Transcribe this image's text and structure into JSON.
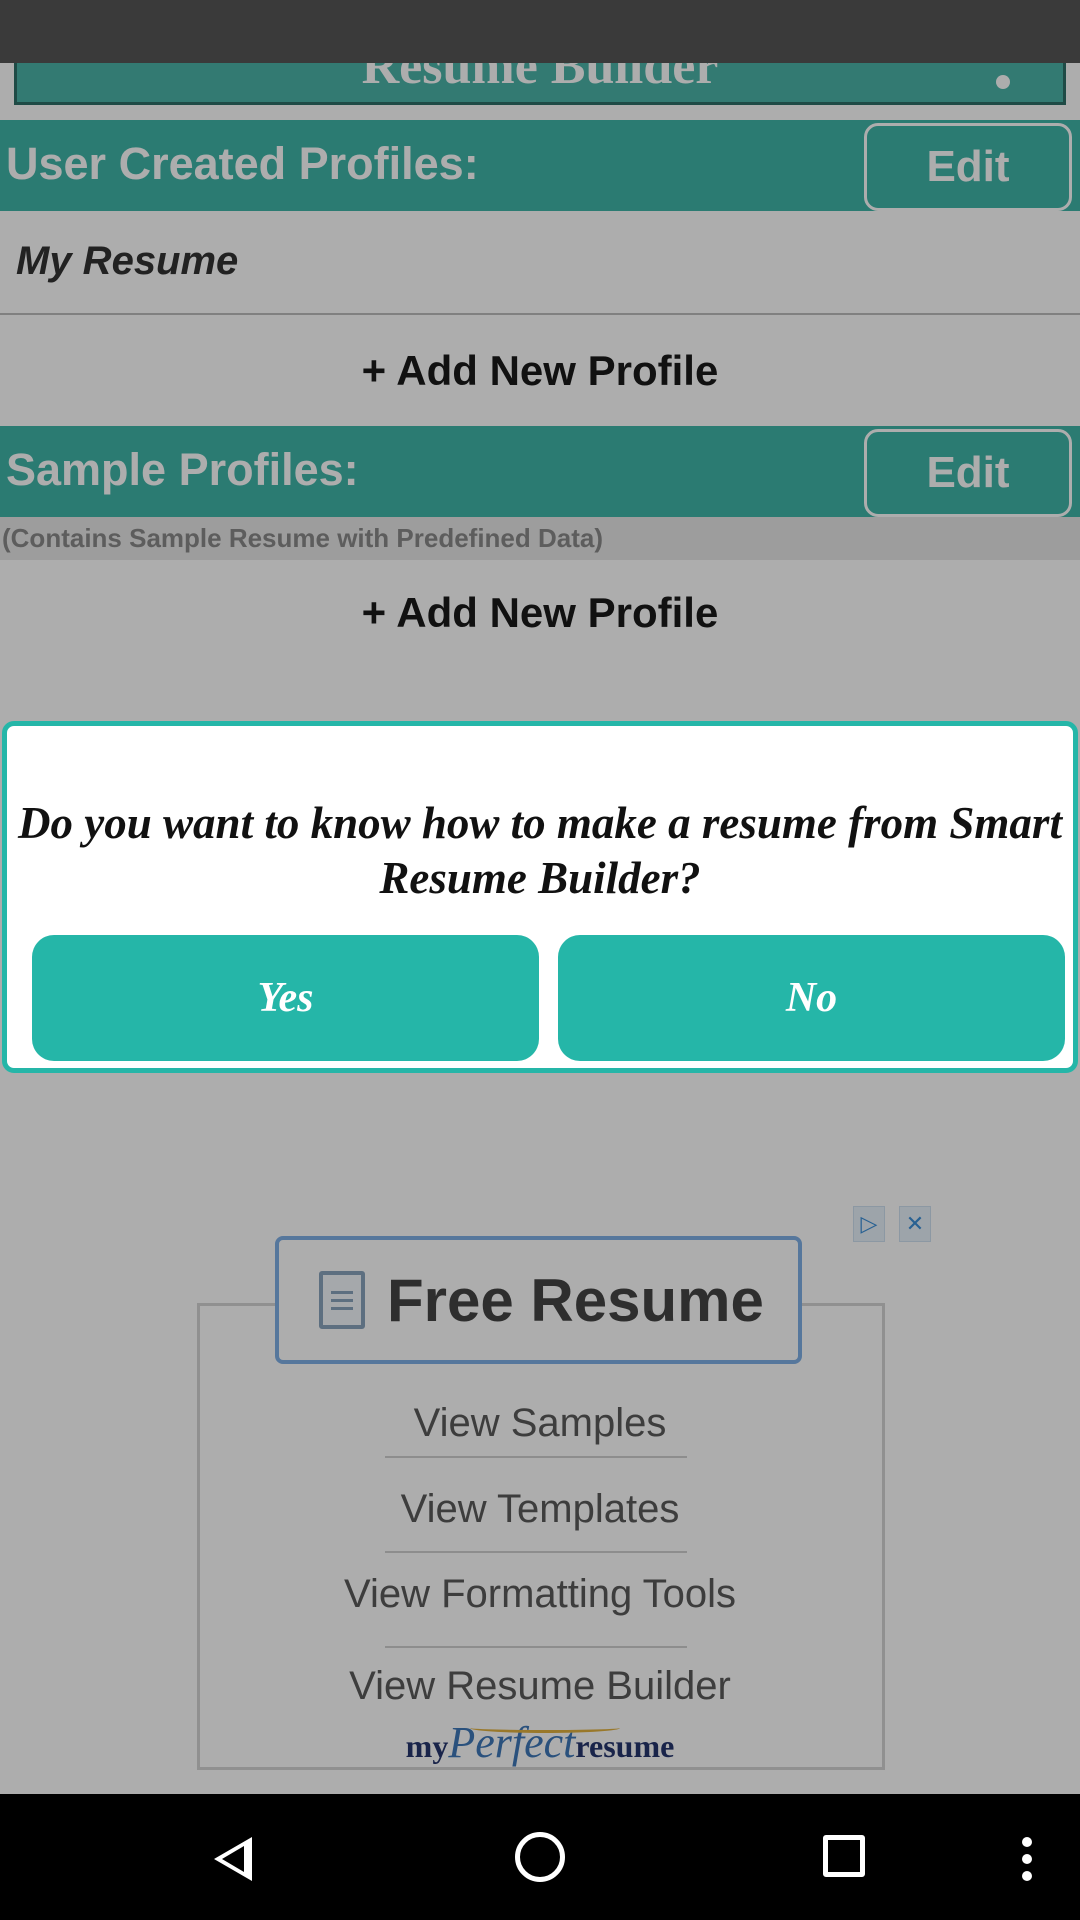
{
  "app_bar": {
    "title": "Resume Builder"
  },
  "user_profiles": {
    "header": "User Created Profiles:",
    "edit_label": "Edit",
    "items": [
      "My Resume"
    ],
    "add_label": "+ Add New Profile"
  },
  "sample_profiles": {
    "header": "Sample Profiles:",
    "edit_label": "Edit",
    "note": "(Contains Sample Resume with Predefined Data)",
    "add_label": "+ Add New Profile"
  },
  "dialog": {
    "message": "Do you want to know how to make a resume from Smart Resume Builder?",
    "yes_label": "Yes",
    "no_label": "No"
  },
  "ad": {
    "title": "Free Resume",
    "links": [
      "View Samples",
      "View Templates",
      "View Formatting Tools",
      "View Resume Builder"
    ],
    "logo_left": "my",
    "logo_mid": "Perfect",
    "logo_right": "resume",
    "adchoices_icon": "play-triangle-icon",
    "close_icon": "close-icon"
  },
  "colors": {
    "accent": "#25b6a8",
    "section_header": "#40b6a8",
    "status_bar": "#3a3a3a",
    "nav_bar": "#000000"
  }
}
